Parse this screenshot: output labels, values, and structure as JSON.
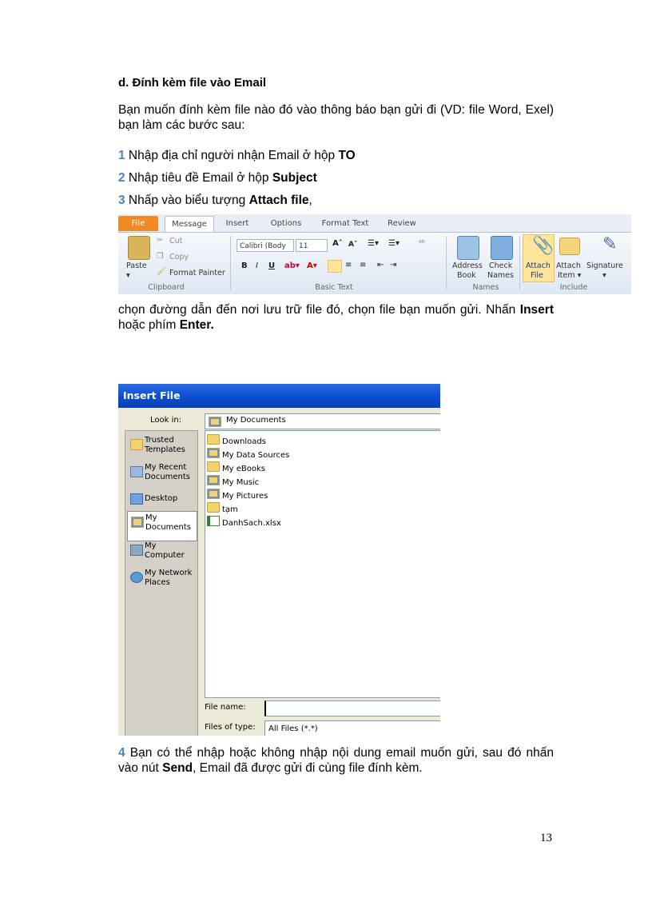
{
  "heading": "d. Đính kèm file vào Email",
  "intro": "Bạn muốn đính kèm file nào đó vào thông báo bạn gửi đi (VD: file Word, Exel) bạn làm các bước sau:",
  "steps": [
    {
      "num": "1",
      "pre": " Nhập địa chỉ người nhận Email ở hộp ",
      "bold": "TO",
      "post": ""
    },
    {
      "num": "2",
      "pre": " Nhập tiêu đề Email ở hộp ",
      "bold": "Subject",
      "post": ""
    },
    {
      "num": "3",
      "pre": " Nhấp vào biểu tượng ",
      "bold": "Attach file",
      "post": ","
    }
  ],
  "after_ribbon": {
    "t1": "chọn đường dẫn đến nơi lưu trữ file đó, chọn file bạn muốn gửi. Nhấn ",
    "b1": "Insert",
    "t2": " hoặc phím ",
    "b2": "Enter."
  },
  "ribbon": {
    "tabs": [
      "File",
      "Message",
      "Insert",
      "Options",
      "Format Text",
      "Review"
    ],
    "clipboard": {
      "paste": "Paste",
      "cut": "Cut",
      "copy": "Copy",
      "format_painter": "Format Painter",
      "label": "Clipboard"
    },
    "basic_text": {
      "font": "Calibri (Body",
      "size": "11",
      "label": "Basic Text"
    },
    "names": {
      "address_book": [
        "Address",
        "Book"
      ],
      "check_names": [
        "Check",
        "Names"
      ],
      "label": "Names"
    },
    "include": {
      "attach_file": [
        "Attach",
        "File"
      ],
      "attach_item": [
        "Attach",
        "Item ▾"
      ],
      "signature": [
        "Signature",
        "▾"
      ],
      "label": "Include"
    }
  },
  "dialog": {
    "title": "Insert File",
    "look_in_label": "Look in:",
    "look_in_value": "My Documents",
    "places": [
      {
        "lines": [
          "Trusted",
          "Templates"
        ],
        "icon": "folder-icon"
      },
      {
        "lines": [
          "My Recent",
          "Documents"
        ],
        "icon": "recent-documents-icon"
      },
      {
        "lines": [
          "Desktop"
        ],
        "icon": "desktop-icon"
      },
      {
        "lines": [
          "My",
          "Documents"
        ],
        "icon": "my-documents-icon",
        "selected": true
      },
      {
        "lines": [
          "My",
          "Computer"
        ],
        "icon": "computer-icon"
      },
      {
        "lines": [
          "My Network",
          "Places"
        ],
        "icon": "network-icon"
      }
    ],
    "files": [
      {
        "name": "Downloads",
        "type": "folder"
      },
      {
        "name": "My Data Sources",
        "type": "sysfolder"
      },
      {
        "name": "My eBooks",
        "type": "folder"
      },
      {
        "name": "My Music",
        "type": "sysfolder"
      },
      {
        "name": "My Pictures",
        "type": "sysfolder"
      },
      {
        "name": "tạm",
        "type": "folder"
      },
      {
        "name": "DanhSach.xlsx",
        "type": "xls"
      }
    ],
    "file_name_label": "File name:",
    "file_name_value": "",
    "files_of_type_label": "Files of type:",
    "files_of_type_value": "All Files (*.*)"
  },
  "step4": {
    "num": "4",
    "t1": " Bạn có thể nhập hoặc không nhập nội dung email muốn gửi, sau đó nhấn vào nút ",
    "b1": "Send",
    "t2": ", Email đã được gửi đi cùng file đính kèm."
  },
  "page_number": "13"
}
